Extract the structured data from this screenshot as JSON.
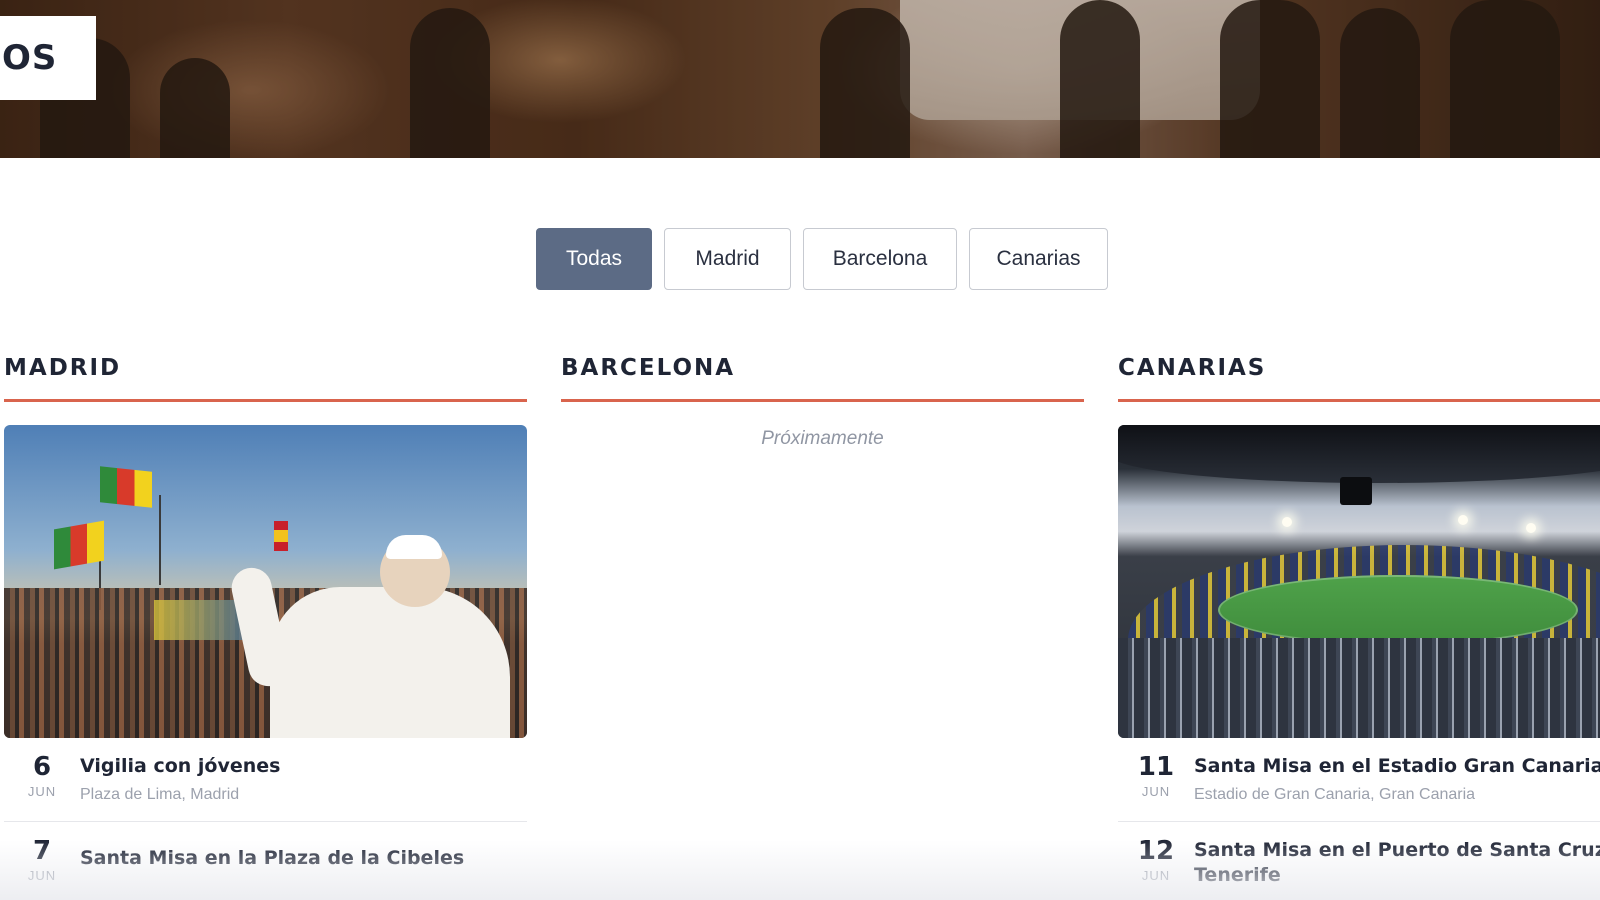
{
  "hero": {
    "title_fragment": "OS"
  },
  "filters": [
    {
      "label": "Todas",
      "active": true
    },
    {
      "label": "Madrid",
      "active": false
    },
    {
      "label": "Barcelona",
      "active": false
    },
    {
      "label": "Canarias",
      "active": false
    }
  ],
  "columns": {
    "madrid": {
      "title": "MADRID",
      "events": [
        {
          "day": "6",
          "month": "JUN",
          "title": "Vigilia con jóvenes",
          "place": "Plaza de Lima, Madrid"
        },
        {
          "day": "7",
          "month": "JUN",
          "title": "Santa Misa en la Plaza de la Cibeles",
          "place": ""
        }
      ]
    },
    "barcelona": {
      "title": "BARCELONA",
      "coming_soon": "Próximamente"
    },
    "canarias": {
      "title": "CANARIAS",
      "events": [
        {
          "day": "11",
          "month": "JUN",
          "title": "Santa Misa en el Estadio Gran Canaria",
          "place": "Estadio de Gran Canaria, Gran Canaria"
        },
        {
          "day": "12",
          "month": "JUN",
          "title": "Santa Misa en el Puerto de Santa Cruz de Tenerife",
          "place": ""
        }
      ]
    }
  },
  "colors": {
    "accent": "#d9644d",
    "active_button": "#5c6b85",
    "text": "#1f2535",
    "muted": "#9ca1ad"
  }
}
